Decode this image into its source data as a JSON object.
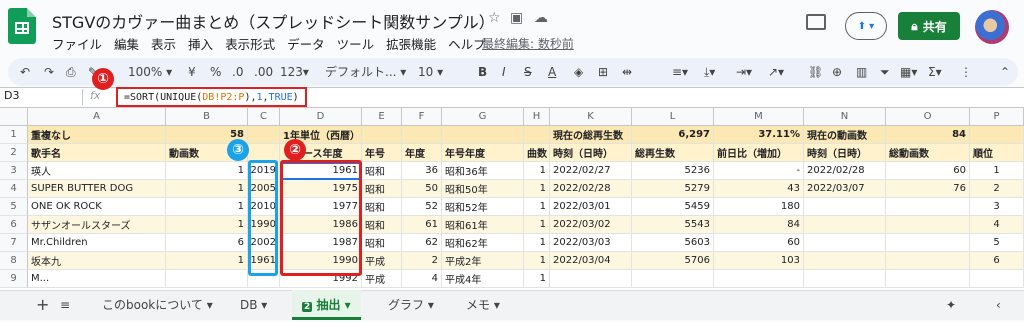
{
  "app": {
    "title": "STGVのカヴァー曲まとめ（スプレッドシート関数サンプル）",
    "menu": [
      "ファイル",
      "編集",
      "表示",
      "挿入",
      "表示形式",
      "データ",
      "ツール",
      "拡張機能",
      "ヘルプ"
    ],
    "last_edit": "最終編集: 数秒前",
    "share_label": "共有"
  },
  "toolbar": {
    "zoom": "100%",
    "currency": "¥",
    "percent": "%",
    "dec_minus": ".0",
    "dec_plus": ".00",
    "format_more": "123",
    "font": "デフォルト...",
    "font_size": "10"
  },
  "formula_bar": {
    "cell_ref": "D3",
    "fx": "fx",
    "formula_prefix": "=SORT(UNIQUE(",
    "formula_ref": "DB!P2:P",
    "formula_mid": "),",
    "formula_n1": "1",
    "formula_comma": ",",
    "formula_bool": "TRUE",
    "formula_suffix": ")"
  },
  "annotations": {
    "one": "①",
    "two": "②",
    "three": "③"
  },
  "columns": [
    "A",
    "B",
    "C",
    "D",
    "E",
    "F",
    "G",
    "H",
    "K",
    "L",
    "M",
    "N",
    "O",
    "P"
  ],
  "row_numbers": [
    "1",
    "2",
    "3",
    "4",
    "5",
    "6",
    "7",
    "8",
    "9"
  ],
  "row1": {
    "a": "重複なし",
    "b": "58",
    "d": "1年単位（西暦）",
    "k": "現在の総再生数",
    "l": "6,297",
    "m": "37.11%",
    "n": "現在の動画数",
    "o": "84"
  },
  "row2": {
    "a": "歌手名",
    "b": "動画数",
    "d": "リリース年度",
    "e": "年号",
    "f": "年度",
    "g": "年号年度",
    "h": "曲数",
    "k": "時刻（日時）",
    "l": "総再生数",
    "m": "前日比（増加）",
    "n": "時刻（日時）",
    "o": "総動画数",
    "p": "順位"
  },
  "rows": [
    {
      "a": "瑛人",
      "b": "1",
      "c": "2019",
      "d": "1961",
      "e": "昭和",
      "f": "36",
      "g": "昭和36年",
      "h": "1",
      "k": "2022/02/27",
      "l": "5236",
      "m": "-",
      "n": "2022/02/28",
      "o": "60",
      "p": "1"
    },
    {
      "a": "SUPER BUTTER DOG",
      "b": "1",
      "c": "2005",
      "d": "1975",
      "e": "昭和",
      "f": "50",
      "g": "昭和50年",
      "h": "1",
      "k": "2022/02/28",
      "l": "5279",
      "m": "43",
      "n": "2022/03/07",
      "o": "76",
      "p": "2"
    },
    {
      "a": "ONE OK ROCK",
      "b": "1",
      "c": "2010",
      "d": "1977",
      "e": "昭和",
      "f": "52",
      "g": "昭和52年",
      "h": "1",
      "k": "2022/03/01",
      "l": "5459",
      "m": "180",
      "n": "",
      "o": "",
      "p": "3"
    },
    {
      "a": "サザンオールスターズ",
      "b": "1",
      "c": "1990",
      "d": "1986",
      "e": "昭和",
      "f": "61",
      "g": "昭和61年",
      "h": "1",
      "k": "2022/03/02",
      "l": "5543",
      "m": "84",
      "n": "",
      "o": "",
      "p": "4"
    },
    {
      "a": "Mr.Children",
      "b": "6",
      "c": "2002",
      "d": "1987",
      "e": "昭和",
      "f": "62",
      "g": "昭和62年",
      "h": "1",
      "k": "2022/03/03",
      "l": "5603",
      "m": "60",
      "n": "",
      "o": "",
      "p": "5"
    },
    {
      "a": "坂本九",
      "b": "1",
      "c": "1961",
      "d": "1990",
      "e": "平成",
      "f": "2",
      "g": "平成2年",
      "h": "1",
      "k": "2022/03/04",
      "l": "5706",
      "m": "103",
      "n": "",
      "o": "",
      "p": "6"
    }
  ],
  "row9_partial": {
    "a": "M...",
    "d": "1992",
    "e": "平成",
    "f": "4",
    "g": "平成4年",
    "h": "1"
  },
  "tabs": [
    "このbookについて",
    "DB",
    "抽出",
    "グラフ",
    "メモ"
  ],
  "colors": {
    "accent": "#188038",
    "header": "#fce8b2",
    "band": "#fef7e0",
    "red": "#e02020",
    "blue": "#1aa3e8"
  }
}
